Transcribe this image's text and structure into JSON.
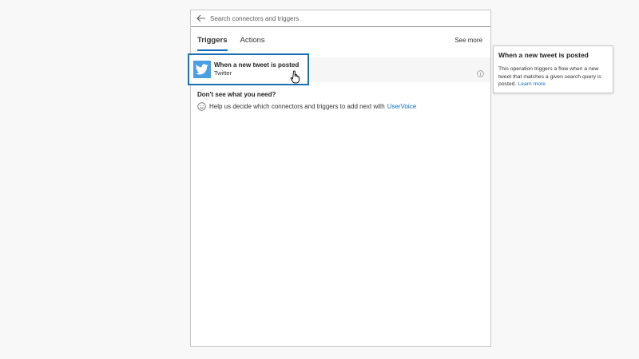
{
  "search": {
    "placeholder": "Search connectors and triggers"
  },
  "tabs": [
    {
      "label": "Triggers",
      "active": true
    },
    {
      "label": "Actions",
      "active": false
    }
  ],
  "see_more_label": "See more",
  "trigger": {
    "title": "When a new tweet is posted",
    "connector": "Twitter",
    "icon": "twitter-bird-icon",
    "brand_color": "#4a9fe2",
    "highlight_color": "#1a6fb5"
  },
  "help": {
    "heading": "Don't see what you need?",
    "text": "Help us decide which connectors and triggers to add next with",
    "link_label": "UserVoice"
  },
  "tooltip": {
    "title": "When a new tweet is posted",
    "body": "This operation triggers a flow when a new tweet that matches a given search query is posted.",
    "link_label": "Learn more"
  },
  "colors": {
    "accent": "#0f6cbd"
  }
}
